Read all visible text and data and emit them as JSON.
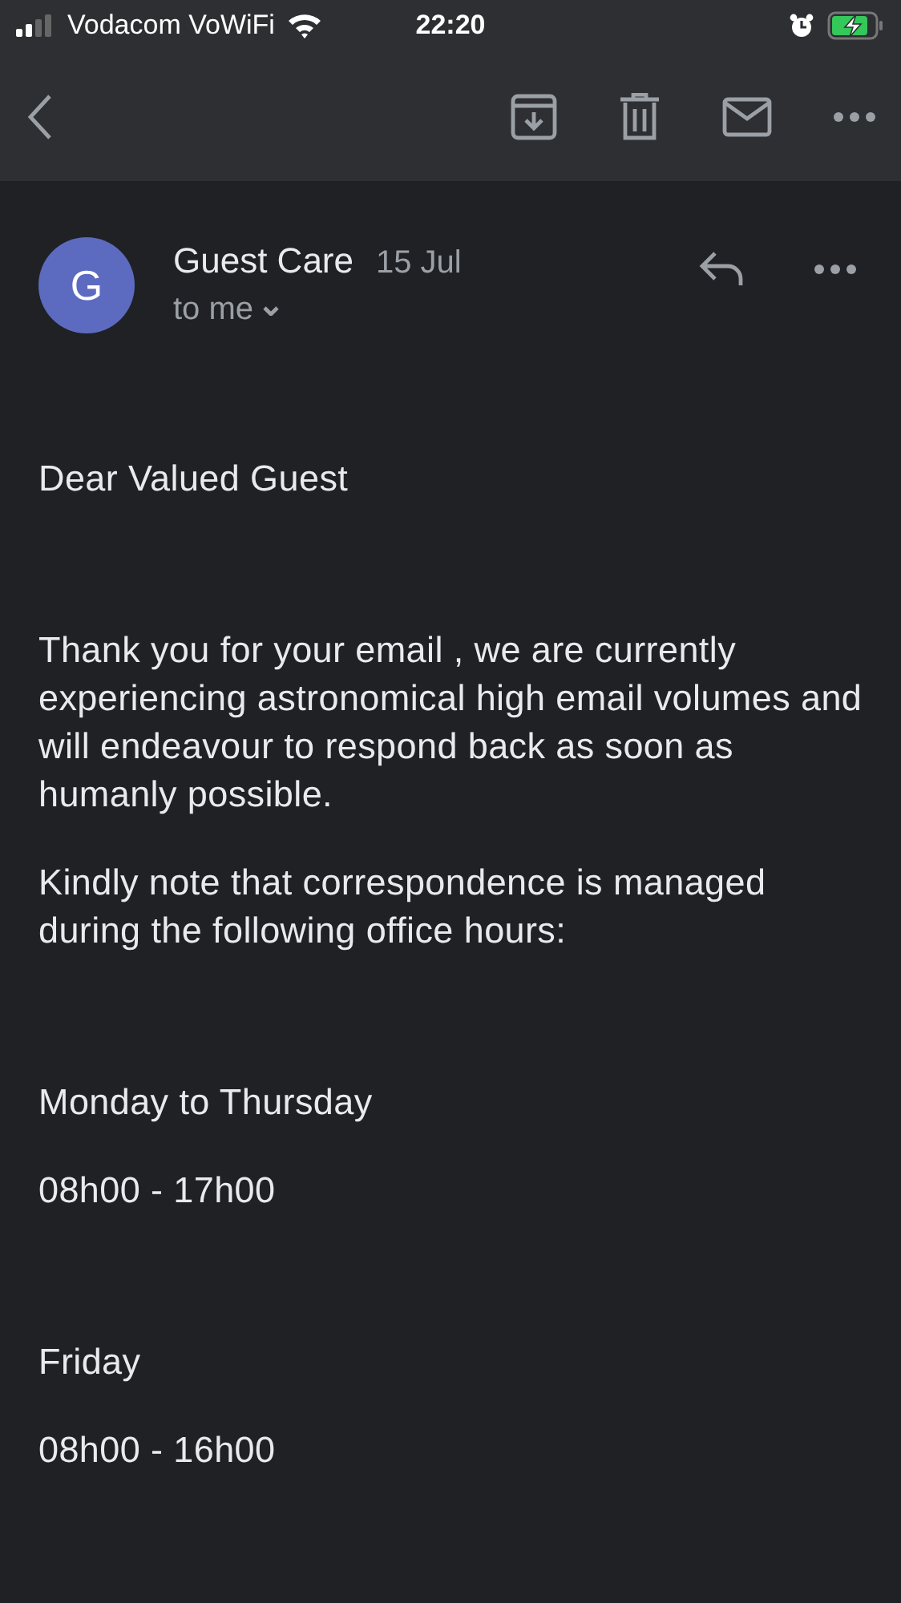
{
  "status_bar": {
    "carrier": "Vodacom VoWiFi",
    "time": "22:20"
  },
  "message": {
    "avatar_letter": "G",
    "sender": "Guest Care",
    "date": "15 Jul",
    "recipient": "to me"
  },
  "body_sections": [
    {
      "paragraphs": [
        "Dear Valued Guest"
      ]
    },
    {
      "paragraphs": [
        "Thank you for your email , we are currently experiencing astronomical high email volumes and will endeavour to respond back as soon as humanly possible.",
        "Kindly note that correspondence is managed during the following office hours:"
      ]
    },
    {
      "paragraphs": [
        "Monday to Thursday",
        "08h00 - 17h00"
      ]
    },
    {
      "paragraphs": [
        "Friday",
        "08h00 - 16h00"
      ]
    }
  ]
}
